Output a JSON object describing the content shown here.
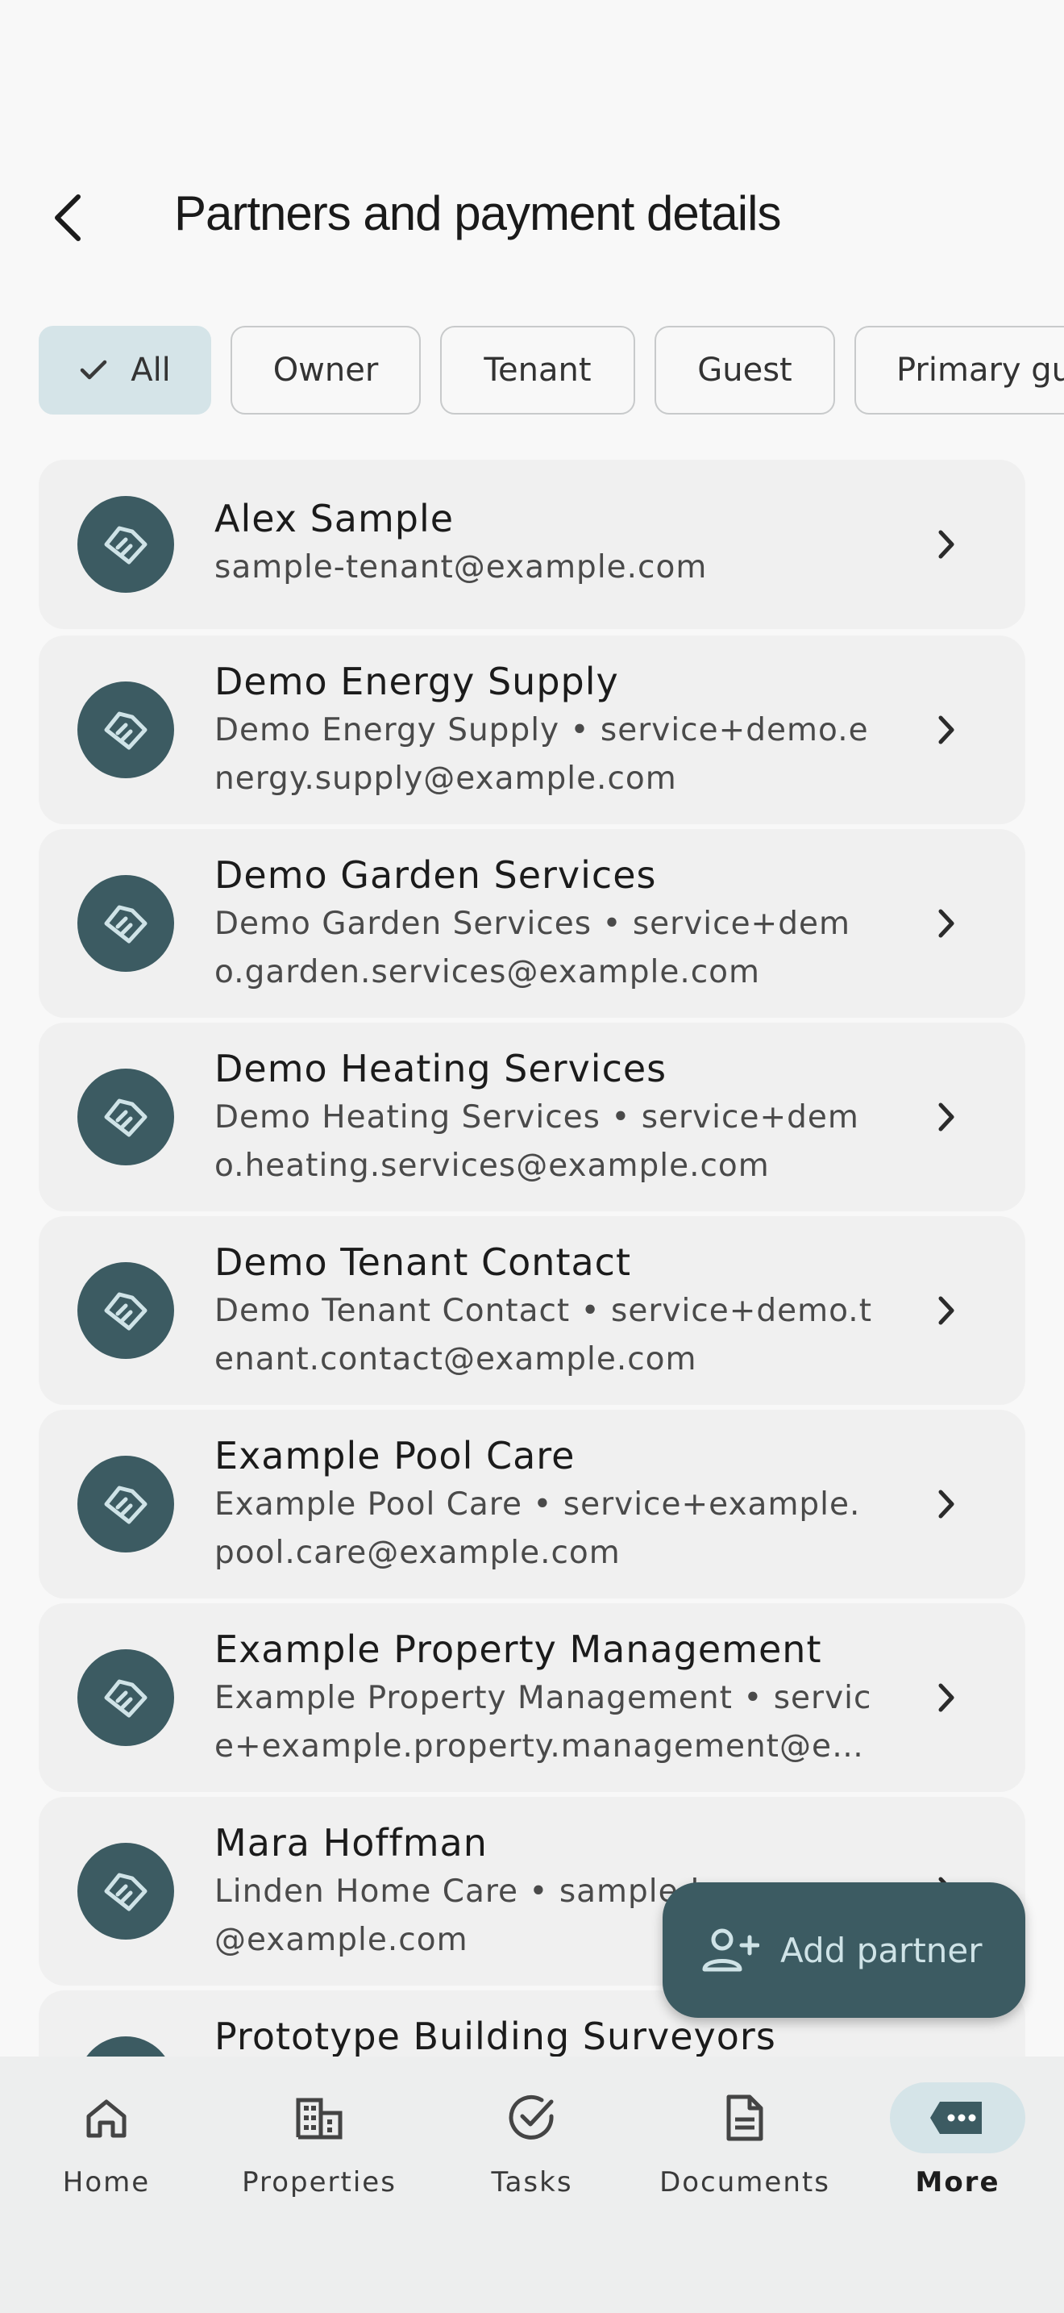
{
  "header": {
    "title": "Partners and payment details"
  },
  "filters": [
    {
      "label": "All",
      "selected": true
    },
    {
      "label": "Owner",
      "selected": false
    },
    {
      "label": "Tenant",
      "selected": false
    },
    {
      "label": "Guest",
      "selected": false
    },
    {
      "label": "Primary gu",
      "selected": false
    }
  ],
  "partners": [
    {
      "name": "Alex Sample",
      "detail": "sample-tenant@example.com"
    },
    {
      "name": "Demo Energy Supply",
      "detail": "Demo Energy Supply • service+demo.energy.supply@example.com"
    },
    {
      "name": "Demo Garden Services",
      "detail": "Demo Garden Services • service+demo.garden.services@example.com"
    },
    {
      "name": "Demo Heating Services",
      "detail": "Demo Heating Services • service+demo.heating.services@example.com"
    },
    {
      "name": "Demo Tenant Contact",
      "detail": "Demo Tenant Contact • service+demo.tenant.contact@example.com"
    },
    {
      "name": "Example Pool Care",
      "detail": "Example Pool Care • service+example.pool.care@example.com"
    },
    {
      "name": "Example Property Management",
      "detail": "Example Property Management • service+example.property.management@ex…"
    },
    {
      "name": "Mara Hoffman",
      "detail": "Linden Home Care • sample-home-care@example.com"
    },
    {
      "name": "Prototype Building Surveyors",
      "detail": ""
    }
  ],
  "fab": {
    "label": "Add partner",
    "icon": "person-add-icon"
  },
  "nav": [
    {
      "label": "Home",
      "icon": "home-icon",
      "active": false
    },
    {
      "label": "Properties",
      "icon": "building-icon",
      "active": false
    },
    {
      "label": "Tasks",
      "icon": "check-circle-icon",
      "active": false
    },
    {
      "label": "Documents",
      "icon": "document-icon",
      "active": false
    },
    {
      "label": "More",
      "icon": "more-icon",
      "active": true
    }
  ],
  "colors": {
    "accent": "#3c5b62",
    "chip_selected": "#d5e4e8",
    "fab_text": "#cfe3e7"
  }
}
